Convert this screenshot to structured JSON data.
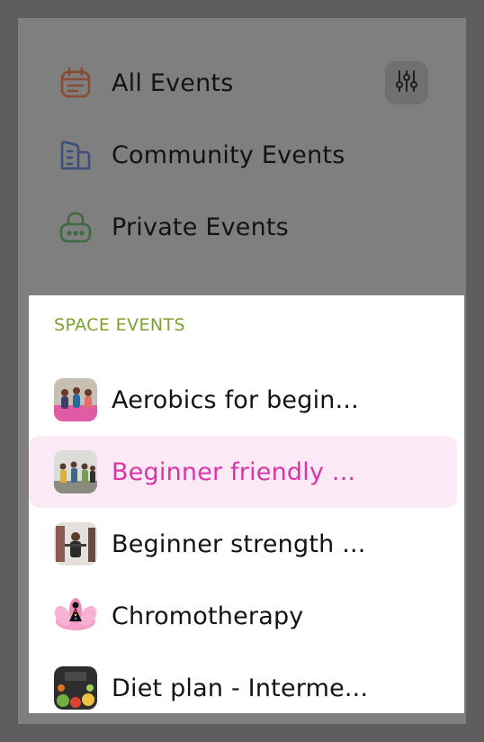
{
  "nav": {
    "items": [
      {
        "label": "All Events",
        "icon": "calendar-icon",
        "color": "#8a4a33"
      },
      {
        "label": "Community Events",
        "icon": "buildings-icon",
        "color": "#3a4f7a"
      },
      {
        "label": "Private Events",
        "icon": "lock-icon",
        "color": "#3f6a3f"
      }
    ],
    "filter_icon": "sliders-icon"
  },
  "space_events": {
    "title": "SPACE EVENTS",
    "items": [
      {
        "label": "Aerobics for begin...",
        "thumb": "aerobics-thumbnail",
        "active": false
      },
      {
        "label": "Beginner friendly ...",
        "thumb": "group-fitness-thumbnail",
        "active": true
      },
      {
        "label": "Beginner strength ...",
        "thumb": "strength-thumbnail",
        "active": false
      },
      {
        "label": "Chromotherapy",
        "thumb": "lotus-meditation-thumbnail",
        "active": false
      },
      {
        "label": "Diet plan - Interme...",
        "thumb": "diet-plan-thumbnail",
        "active": false
      }
    ]
  },
  "colors": {
    "accent": "#d934a8",
    "section_title": "#7aa22c",
    "active_bg": "#fbe9f5",
    "overlay": "#7f7f7f"
  }
}
